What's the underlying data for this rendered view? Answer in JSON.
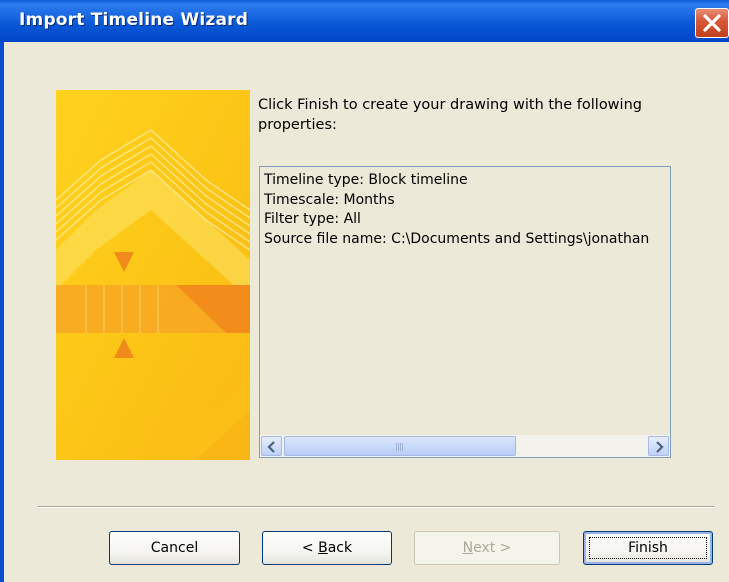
{
  "window": {
    "title": "Import Timeline Wizard",
    "close_icon": "close-x-icon"
  },
  "message": "Click Finish to create your drawing with the following properties:",
  "properties": {
    "lines": [
      "Timeline type: Block timeline",
      "Timescale: Months",
      "Filter type: All",
      "Source file name: C:\\Documents and Settings\\jonathan"
    ],
    "scrollbar": {
      "left_icon": "chevron-left-icon",
      "right_icon": "chevron-right-icon",
      "thumb_fraction_start": 0.0,
      "thumb_fraction_visible": 0.6
    }
  },
  "buttons": {
    "cancel": "Cancel",
    "back_prefix": "< ",
    "back_accel": "B",
    "back_rest": "ack",
    "next_accel": "N",
    "next_rest": "ext >",
    "finish": "Finish"
  },
  "colors": {
    "titlebar": "#0a5ad8",
    "dialog_bg": "#ece9d8",
    "banner_yellow": "#fcc21a",
    "banner_orange": "#f39a1f"
  }
}
